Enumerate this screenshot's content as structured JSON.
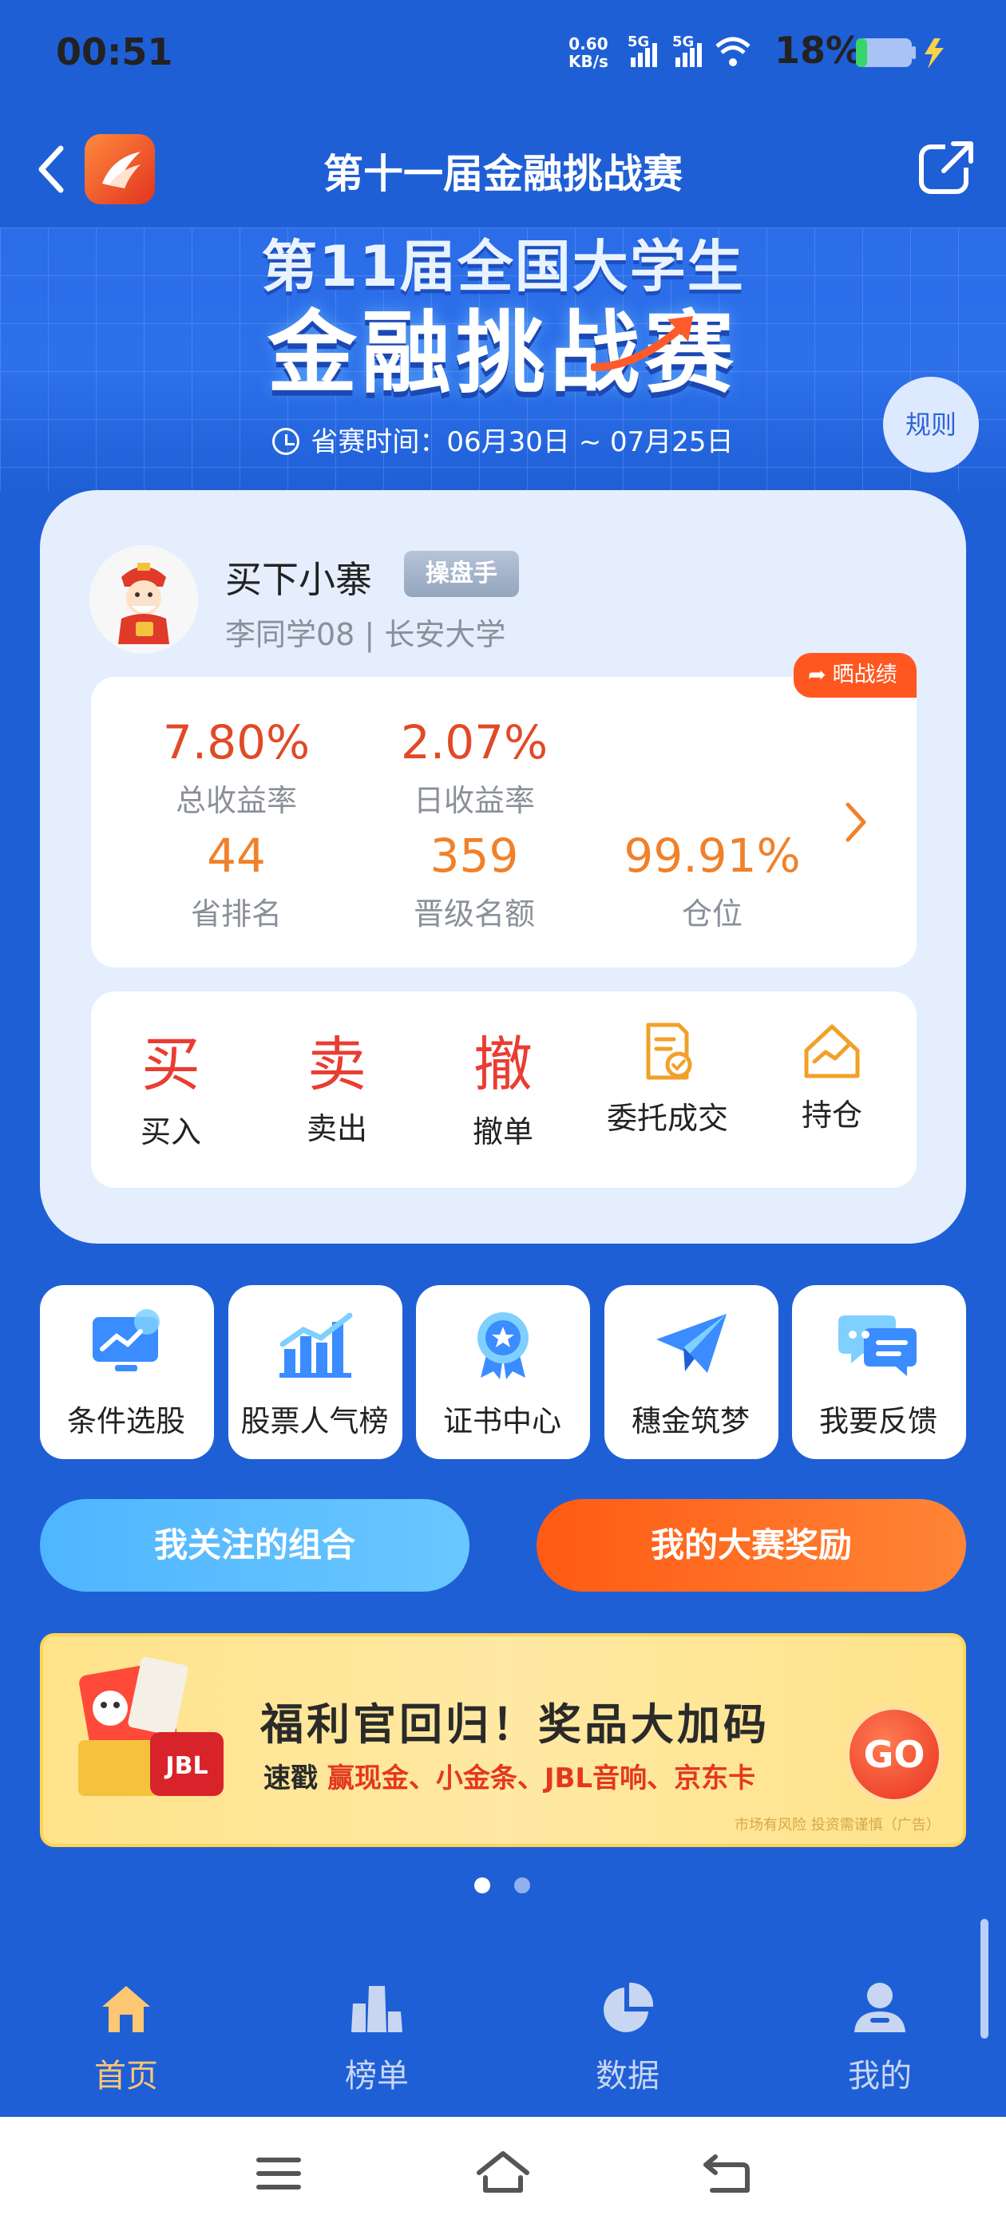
{
  "status_bar": {
    "time": "00:51",
    "net_speed_value": "0.60",
    "net_speed_unit": "KB/s",
    "signal1": "5G",
    "signal2": "5G",
    "battery": "18%"
  },
  "header": {
    "title": "第十一届金融挑战赛"
  },
  "banner": {
    "line1": "第11届全国大学生",
    "line2": "金融挑战赛",
    "time_text": "省赛时间：06月30日 ~ 07月25日",
    "rules_label": "规则"
  },
  "profile": {
    "username": "买下小寨",
    "role": "操盘手",
    "subtitle": "李同学08 | 长安大学",
    "share_label": "晒战绩"
  },
  "stats": {
    "total_return": {
      "value": "7.80%",
      "label": "总收益率"
    },
    "daily_return": {
      "value": "2.07%",
      "label": "日收益率"
    },
    "province_rank": {
      "value": "44",
      "label": "省排名"
    },
    "promotion_quota": {
      "value": "359",
      "label": "晋级名额"
    },
    "position": {
      "value": "99.91%",
      "label": "仓位"
    }
  },
  "actions": [
    {
      "char": "买",
      "label": "买入"
    },
    {
      "char": "卖",
      "label": "卖出"
    },
    {
      "char": "撤",
      "label": "撤单"
    },
    {
      "label": "委托成交",
      "icon": "order-doc-icon"
    },
    {
      "label": "持仓",
      "icon": "house-chart-icon"
    }
  ],
  "tiles": [
    {
      "label": "条件选股",
      "icon": "monitor-icon"
    },
    {
      "label": "股票人气榜",
      "icon": "bar-chart-icon"
    },
    {
      "label": "证书中心",
      "icon": "medal-icon"
    },
    {
      "label": "穗金筑梦",
      "icon": "paper-plane-icon"
    },
    {
      "label": "我要反馈",
      "icon": "chat-bubble-icon"
    }
  ],
  "buttons": {
    "watch_combos": "我关注的组合",
    "rewards": "我的大赛奖励"
  },
  "ad": {
    "title": "福利官回归！奖品大加码",
    "sub_prefix": "速戳",
    "sub_items": "赢现金、小金条、JBL音响、京东卡",
    "note": "市场有风险 投资需谨慎（广告）",
    "go": "GO",
    "gift_brand": "JBL"
  },
  "tabbar": [
    {
      "label": "首页",
      "icon": "home-icon",
      "active": true
    },
    {
      "label": "榜单",
      "icon": "ranking-icon",
      "active": false
    },
    {
      "label": "数据",
      "icon": "pie-chart-icon",
      "active": false
    },
    {
      "label": "我的",
      "icon": "user-icon",
      "active": false
    }
  ],
  "colors": {
    "primary_blue": "#1f5fd6",
    "red": "#e04a27",
    "orange": "#f0812a",
    "accent_orange": "#ff5a13",
    "active_tab": "#ffc773"
  }
}
